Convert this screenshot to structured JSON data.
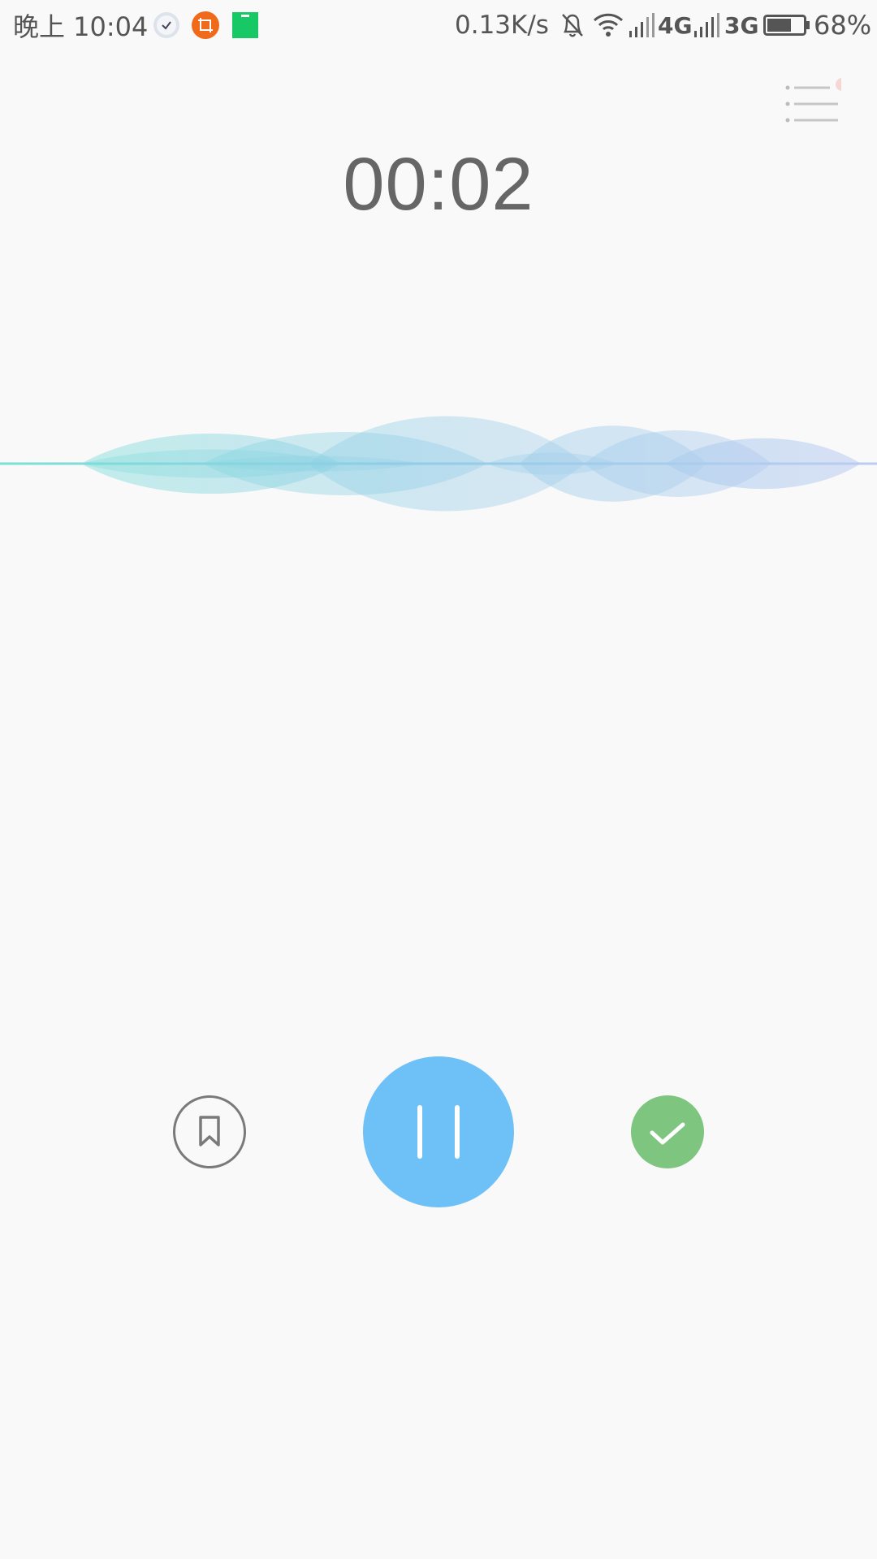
{
  "status_bar": {
    "time": "晚上 10:04",
    "net_speed": "0.13K/s",
    "network_1": "4G",
    "network_2": "3G",
    "battery_percent": "68%",
    "battery_level": 0.68,
    "notification_icons": [
      "clock-icon",
      "crop-icon",
      "book-icon"
    ],
    "system_icons": [
      "bell-off-icon",
      "wifi-icon",
      "signal-icon",
      "signal-icon",
      "battery-icon"
    ]
  },
  "recorder": {
    "elapsed_time": "00:02",
    "state": "recording"
  },
  "controls": {
    "bookmark_icon": "bookmark-icon",
    "pause_icon": "pause-icon",
    "done_icon": "check-icon"
  },
  "colors": {
    "background": "#f9f9f9",
    "pause_button": "#6ec1f7",
    "done_button": "#7ec57f",
    "wave_start": "#7fdcd6",
    "wave_end": "#b8c8f0",
    "menu_badge": "#f7d6d6"
  }
}
